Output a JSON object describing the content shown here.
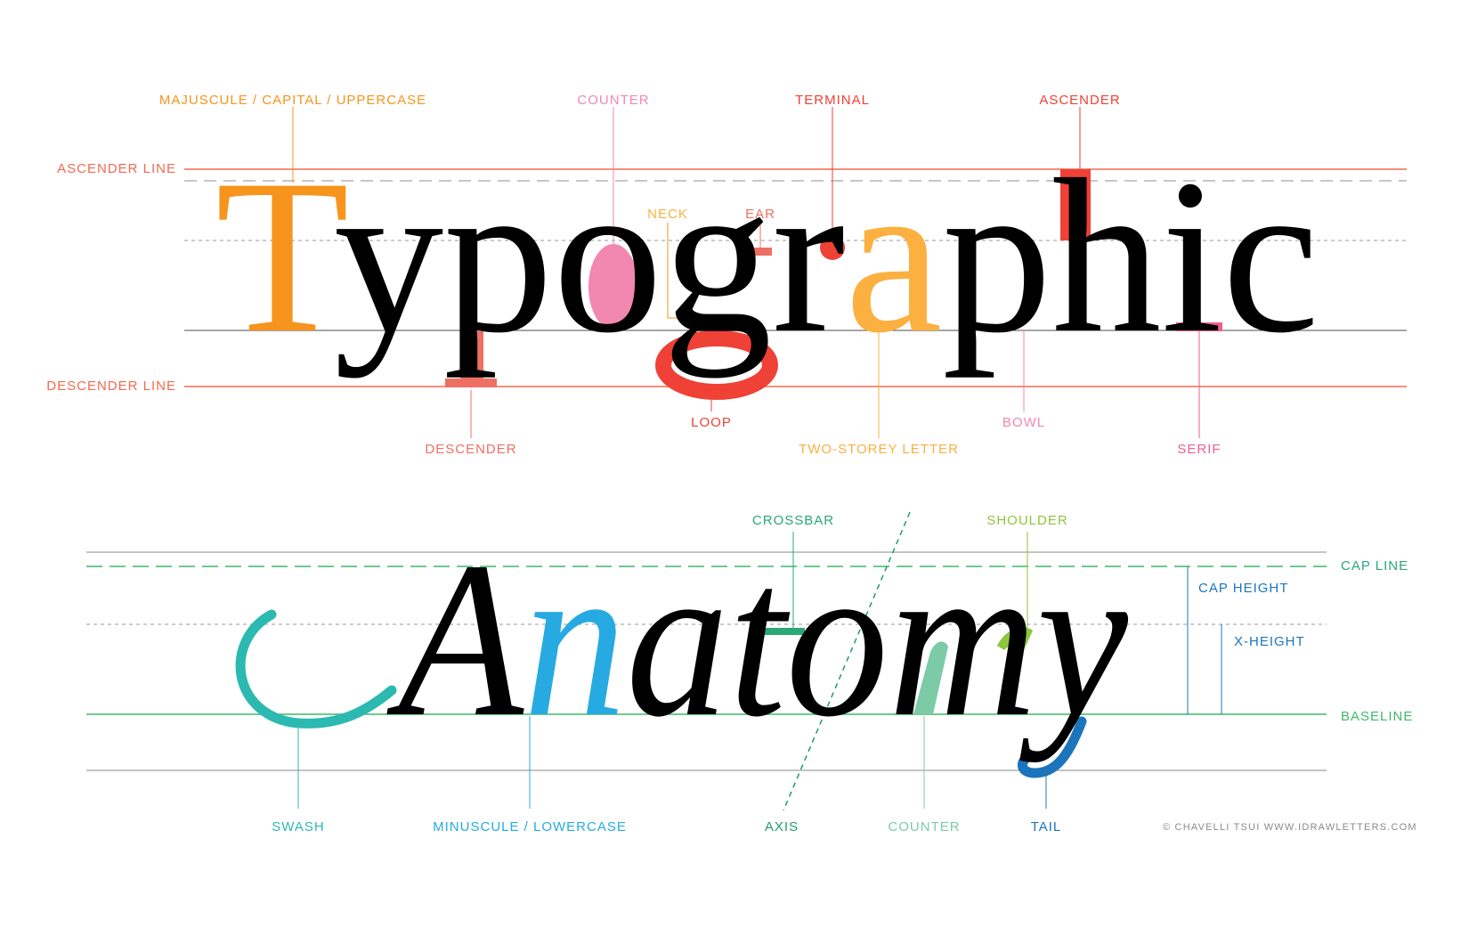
{
  "top": {
    "word": "Typographic",
    "labels": {
      "majuscule": "MAJUSCULE / CAPITAL / UPPERCASE",
      "counter": "COUNTER",
      "terminal": "TERMINAL",
      "ascender": "ASCENDER",
      "ascender_line": "ASCENDER LINE",
      "neck": "NECK",
      "ear": "EAR",
      "descender_line": "DESCENDER LINE",
      "descender": "DESCENDER",
      "loop": "LOOP",
      "two_storey": "TWO-STOREY LETTER",
      "bowl": "BOWL",
      "serif": "SERIF"
    }
  },
  "bottom": {
    "word": "Anatomy",
    "labels": {
      "crossbar": "CROSSBAR",
      "shoulder": "SHOULDER",
      "cap_line": "CAP LINE",
      "cap_height": "CAP HEIGHT",
      "x_height": "X-HEIGHT",
      "baseline": "BASELINE",
      "swash": "SWASH",
      "minuscule": "MINUSCULE / LOWERCASE",
      "axis": "AXIS",
      "counter": "COUNTER",
      "tail": "TAIL"
    }
  },
  "credit": "© CHAVELLI TSUI WWW.IDRAWLETTERS.COM",
  "colors": {
    "orange": "#f7941d",
    "pink": "#f287b0",
    "red": "#ef4136",
    "salmon": "#ee6f63",
    "yellow_orange": "#fbb040",
    "teal": "#2bb9b1",
    "blue": "#27aae1",
    "green": "#3fb96a",
    "lime": "#8dc63f",
    "mint": "#7ccba6",
    "dark_blue": "#1c75bc"
  }
}
